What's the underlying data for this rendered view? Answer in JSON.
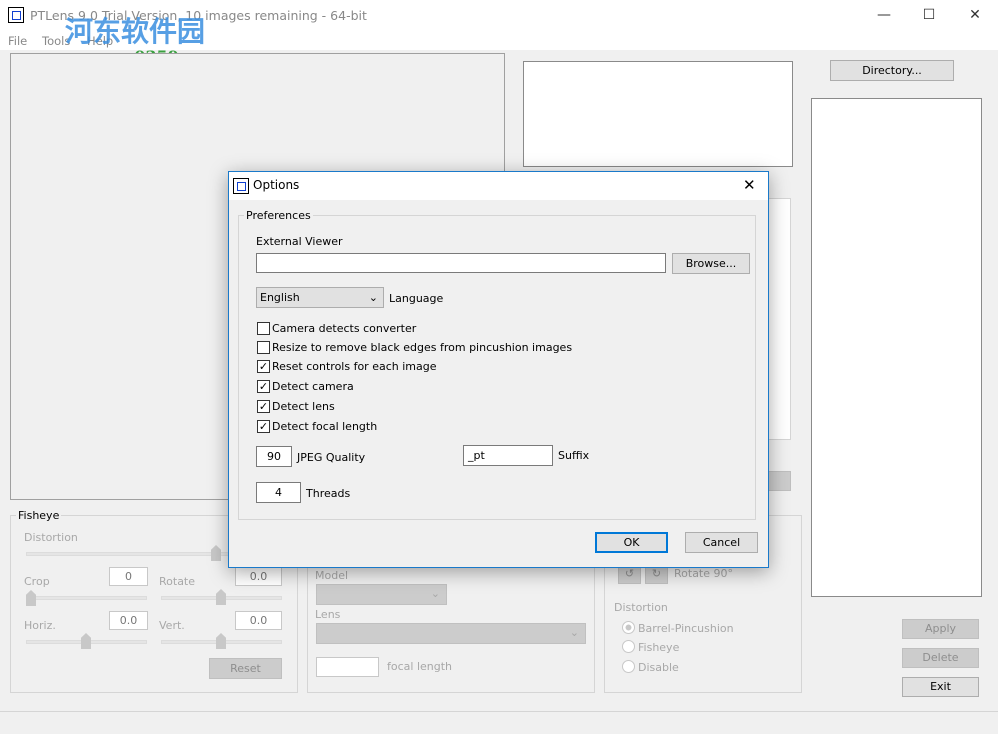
{
  "window": {
    "title": "PTLens 9.0 Trial Version, 10 images remaining - 64-bit",
    "minimize": "—",
    "maximize": "☐",
    "close": "✕"
  },
  "menu": [
    "File",
    "Tools",
    "Help"
  ],
  "watermark": {
    "name": "河东软件园",
    "url": "www.pc0359.cn"
  },
  "directory_button": "Directory...",
  "fisheye": {
    "label": "Fisheye",
    "distortion": "Distortion",
    "crop": "Crop",
    "crop_value": "0",
    "rotate": "Rotate",
    "rotate_value": "0.0",
    "horiz": "Horiz.",
    "horiz_value": "0.0",
    "vert": "Vert.",
    "vert_value": "0.0",
    "reset": "Reset"
  },
  "lens_group": {
    "model": "Model",
    "lens": "Lens",
    "focal_length": "focal length"
  },
  "rotate_group": {
    "rotate90": "Rotate 90°",
    "distortion": "Distortion",
    "options": [
      "Barrel-Pincushion",
      "Fisheye",
      "Disable"
    ],
    "selected": "Barrel-Pincushion"
  },
  "actions": {
    "apply": "Apply",
    "delete": "Delete",
    "exit": "Exit"
  },
  "dialog": {
    "title": "Options",
    "close": "✕",
    "preferences": "Preferences",
    "external_viewer": "External Viewer",
    "external_viewer_value": "",
    "browse": "Browse...",
    "language_value": "English",
    "language": "Language",
    "checkboxes": [
      {
        "label": "Camera detects converter",
        "checked": false
      },
      {
        "label": "Resize to remove black edges from pincushion images",
        "checked": false
      },
      {
        "label": "Reset controls for each image",
        "checked": true
      },
      {
        "label": "Detect camera",
        "checked": true
      },
      {
        "label": "Detect lens",
        "checked": true
      },
      {
        "label": "Detect focal length",
        "checked": true
      }
    ],
    "check_mark": "✓",
    "jpeg_quality_value": "90",
    "jpeg_quality": "JPEG Quality",
    "suffix_value": "_pt",
    "suffix": "Suffix",
    "threads_value": "4",
    "threads": "Threads",
    "ok": "OK",
    "cancel": "Cancel"
  }
}
